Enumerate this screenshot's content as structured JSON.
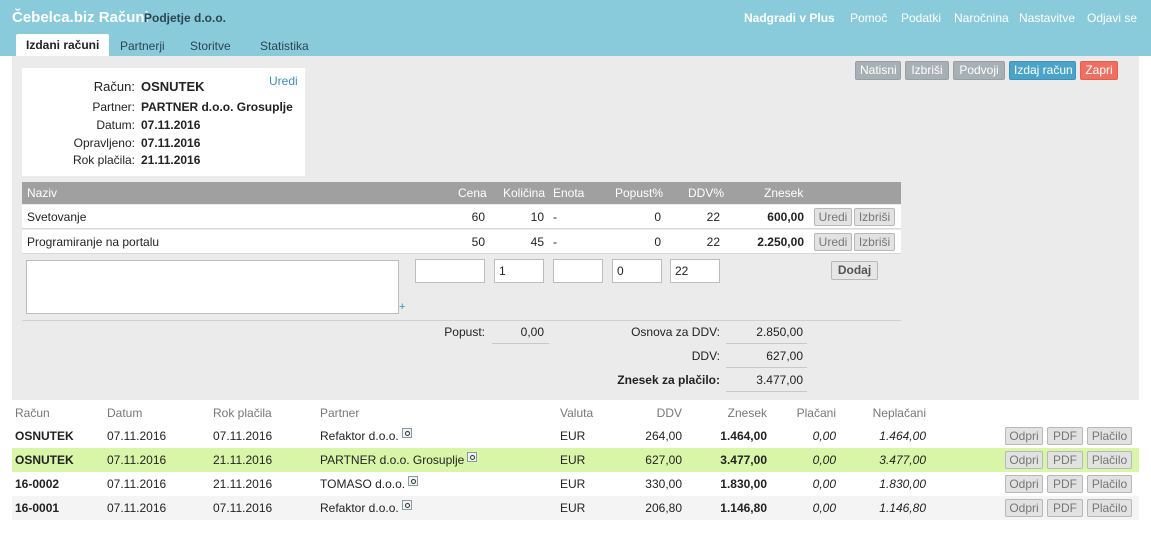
{
  "app": {
    "title": "Čebelca.biz Računi",
    "company": "Podjetje d.o.o."
  },
  "top_nav": [
    "Nadgradi v Plus",
    "Pomoč",
    "Podatki",
    "Naročnina",
    "Nastavitve",
    "Odjavi se"
  ],
  "tabs": [
    "Izdani računi",
    "Partnerji",
    "Storitve",
    "Statistika"
  ],
  "actions": {
    "print": "Natisni",
    "delete": "Izbriši",
    "duplicate": "Podvoji",
    "issue": "Izdaj račun",
    "close": "Zapri"
  },
  "invoice": {
    "edit": "Uredi",
    "labels": {
      "invoice": "Račun:",
      "partner": "Partner:",
      "date": "Datum:",
      "performed": "Opravljeno:",
      "due": "Rok plačila:"
    },
    "number": "OSNUTEK",
    "partner": "PARTNER d.o.o. Grosuplje",
    "date": "07.11.2016",
    "performed": "07.11.2016",
    "due": "21.11.2016"
  },
  "items": {
    "headers": {
      "name": "Naziv",
      "price": "Cena",
      "qty": "Količina",
      "unit": "Enota",
      "discount": "Popust%",
      "vat": "DDV%",
      "amount": "Znesek"
    },
    "rows": [
      {
        "name": "Svetovanje",
        "price": "60",
        "qty": "10",
        "unit": "-",
        "discount": "0",
        "vat": "22",
        "amount": "600,00",
        "edit": "Uredi",
        "delete": "Izbriši"
      },
      {
        "name": "Programiranje na portalu",
        "price": "50",
        "qty": "45",
        "unit": "-",
        "discount": "0",
        "vat": "22",
        "amount": "2.250,00",
        "edit": "Uredi",
        "delete": "Izbriši"
      }
    ],
    "new": {
      "name": "",
      "price": "",
      "qty": "1",
      "unit": "",
      "discount": "0",
      "vat": "22",
      "add": "Dodaj"
    }
  },
  "totals": {
    "discount_label": "Popust:",
    "discount_value": "0,00",
    "base_label": "Osnova za DDV:",
    "base_value": "2.850,00",
    "vat_label": "DDV:",
    "vat_value": "627,00",
    "total_label": "Znesek za plačilo:",
    "total_value": "3.477,00"
  },
  "list": {
    "headers": {
      "invoice": "Račun",
      "date": "Datum",
      "due": "Rok plačila",
      "partner": "Partner",
      "currency": "Valuta",
      "vat": "DDV",
      "amount": "Znesek",
      "paid": "Plačani",
      "unpaid": "Neplačani"
    },
    "buttons": {
      "open": "Odpri",
      "pdf": "PDF",
      "pay": "Plačilo"
    },
    "rows": [
      {
        "invoice": "OSNUTEK",
        "date": "07.11.2016",
        "due": "07.11.2016",
        "partner": "Refaktor d.o.o.",
        "currency": "EUR",
        "vat": "264,00",
        "amount": "1.464,00",
        "paid": "0,00",
        "unpaid": "1.464,00"
      },
      {
        "invoice": "OSNUTEK",
        "date": "07.11.2016",
        "due": "21.11.2016",
        "partner": "PARTNER d.o.o. Grosuplje",
        "currency": "EUR",
        "vat": "627,00",
        "amount": "3.477,00",
        "paid": "0,00",
        "unpaid": "3.477,00"
      },
      {
        "invoice": "16-0002",
        "date": "07.11.2016",
        "due": "21.11.2016",
        "partner": "TOMASO d.o.o.",
        "currency": "EUR",
        "vat": "330,00",
        "amount": "1.830,00",
        "paid": "0,00",
        "unpaid": "1.830,00"
      },
      {
        "invoice": "16-0001",
        "date": "07.11.2016",
        "due": "07.11.2016",
        "partner": "Refaktor d.o.o.",
        "currency": "EUR",
        "vat": "206,80",
        "amount": "1.146,80",
        "paid": "0,00",
        "unpaid": "1.146,80"
      }
    ]
  },
  "colors": {
    "header": "#89cbdb",
    "selected_row": "#d9f5a8",
    "issue_button": "#4aa4c9",
    "close_button": "#ef6f60"
  }
}
